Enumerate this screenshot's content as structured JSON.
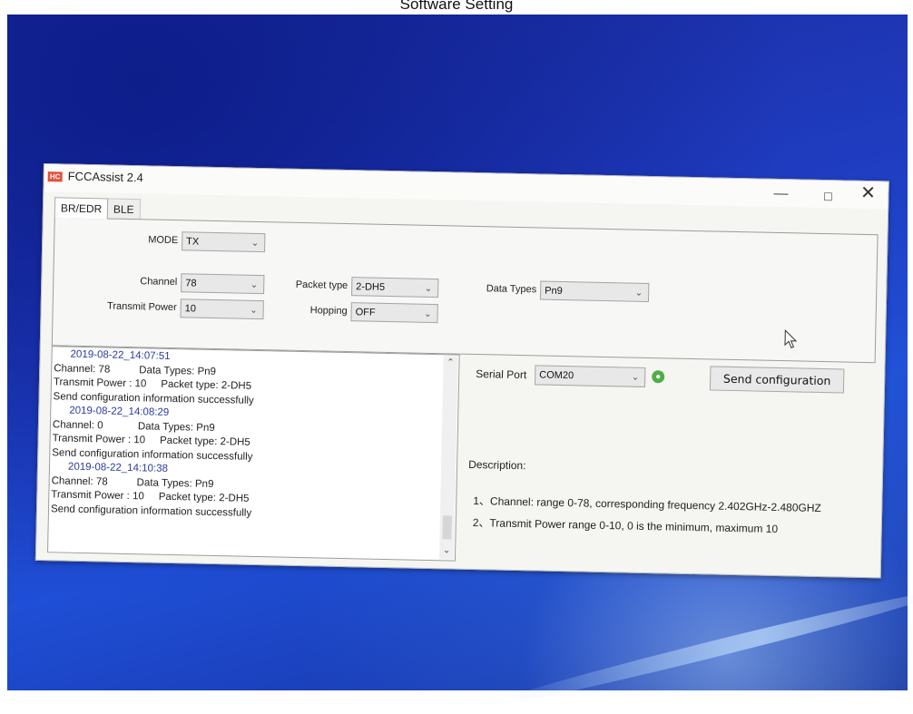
{
  "caption": "Software Setting",
  "window": {
    "title": "FCCAssist 2.4",
    "logo_text": "HC",
    "controls": {
      "minimize": "—",
      "maximize": "☐",
      "close": "✕"
    }
  },
  "tabs": [
    {
      "label": "BR/EDR",
      "active": true
    },
    {
      "label": "BLE",
      "active": false
    }
  ],
  "settings": {
    "mode": {
      "label": "MODE",
      "value": "TX"
    },
    "channel": {
      "label": "Channel",
      "value": "78"
    },
    "transmit_power": {
      "label": "Transmit Power",
      "value": "10"
    },
    "packet_type": {
      "label": "Packet type",
      "value": "2-DH5"
    },
    "hopping": {
      "label": "Hopping",
      "value": "OFF"
    },
    "data_types": {
      "label": "Data Types",
      "value": "Pn9"
    }
  },
  "log": [
    {
      "kind": "ts",
      "text": "2019-08-22_14:07:51"
    },
    {
      "kind": "line",
      "text": "Channel: 78          Data Types: Pn9"
    },
    {
      "kind": "line",
      "text": "Transmit Power : 10     Packet type: 2-DH5"
    },
    {
      "kind": "line",
      "text": "Send configuration information successfully"
    },
    {
      "kind": "ts",
      "text": "2019-08-22_14:08:29"
    },
    {
      "kind": "line",
      "text": "Channel: 0            Data Types: Pn9"
    },
    {
      "kind": "line",
      "text": "Transmit Power : 10     Packet type: 2-DH5"
    },
    {
      "kind": "line",
      "text": "Send configuration information successfully"
    },
    {
      "kind": "ts",
      "text": "2019-08-22_14:10:38"
    },
    {
      "kind": "line",
      "text": "Channel: 78          Data Types: Pn9"
    },
    {
      "kind": "line",
      "text": "Transmit Power : 10     Packet type: 2-DH5"
    },
    {
      "kind": "line",
      "text": "Send configuration information successfully"
    }
  ],
  "serial": {
    "label": "Serial Port",
    "value": "COM20",
    "status_color": "#4fae45"
  },
  "send_button": "Send configuration",
  "description": {
    "title": "Description:",
    "items": [
      "1、Channel: range 0-78, corresponding frequency 2.402GHz-2.480GHZ",
      "2、Transmit Power  range 0-10, 0 is the minimum, maximum 10"
    ]
  }
}
